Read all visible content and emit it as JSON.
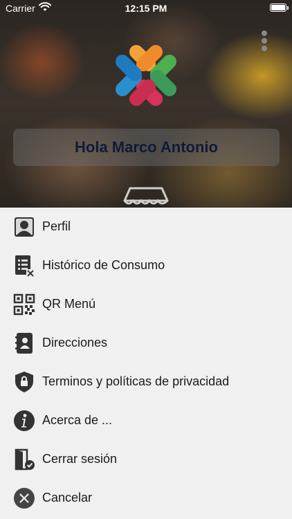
{
  "status_bar": {
    "carrier": "Carrier",
    "time": "12:15 PM"
  },
  "header": {
    "greeting": "Hola Marco Antonio"
  },
  "menu": {
    "items": [
      {
        "label": "Perfil",
        "icon": "profile-icon"
      },
      {
        "label": "Histórico de Consumo",
        "icon": "receipt-history-icon"
      },
      {
        "label": "QR Menú",
        "icon": "qr-code-icon"
      },
      {
        "label": "Direcciones",
        "icon": "address-book-icon"
      },
      {
        "label": "Terminos y políticas de privacidad",
        "icon": "shield-lock-icon"
      },
      {
        "label": "Acerca de ...",
        "icon": "info-icon"
      },
      {
        "label": "Cerrar sesión",
        "icon": "logout-door-icon"
      },
      {
        "label": "Cancelar",
        "icon": "close-circle-icon"
      }
    ]
  },
  "colors": {
    "logo_orange": "#f3a23a",
    "logo_green": "#4caf50",
    "logo_red": "#d6345a",
    "logo_blue": "#2a8fcf",
    "icon_dark": "#333333"
  }
}
